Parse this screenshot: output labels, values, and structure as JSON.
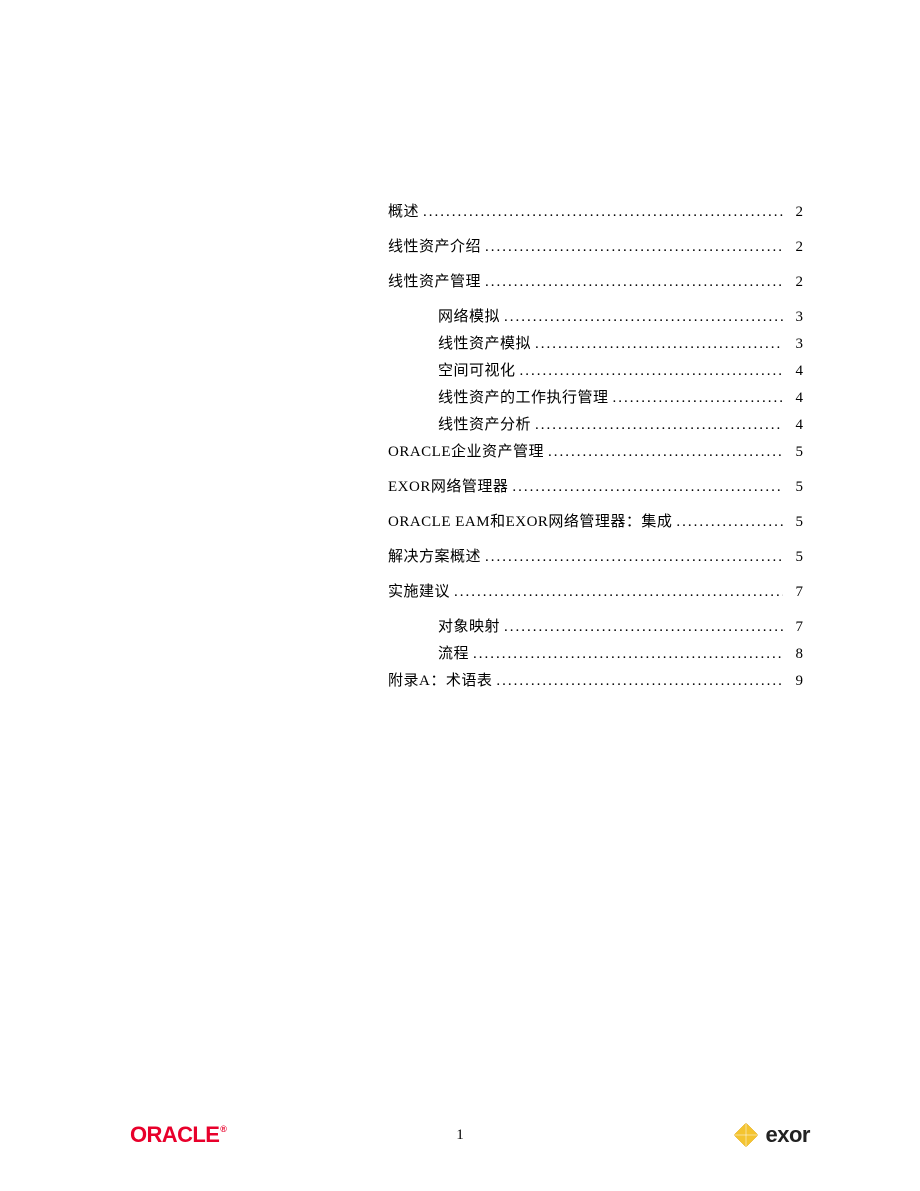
{
  "toc": [
    {
      "label": "概述",
      "page": "2",
      "level": 0
    },
    {
      "label": "线性资产介绍",
      "page": "2",
      "level": 0
    },
    {
      "label": "线性资产管理",
      "page": "2",
      "level": 0
    },
    {
      "label": "网络模拟",
      "page": "3",
      "level": 1
    },
    {
      "label": "线性资产模拟",
      "page": "3",
      "level": 1
    },
    {
      "label": "空间可视化",
      "page": "4",
      "level": 1
    },
    {
      "label": "线性资产的工作执行管理",
      "page": "4",
      "level": 1
    },
    {
      "label": "线性资产分析",
      "page": "4",
      "level": 1
    },
    {
      "label": "ORACLE企业资产管理",
      "page": "5",
      "level": 0
    },
    {
      "label": "EXOR网络管理器",
      "page": "5",
      "level": 0
    },
    {
      "label": "ORACLE EAM和EXOR网络管理器：集成",
      "page": "5",
      "level": 0
    },
    {
      "label": "解决方案概述",
      "page": "5",
      "level": 0
    },
    {
      "label": "实施建议",
      "page": "7",
      "level": 0
    },
    {
      "label": "对象映射",
      "page": "7",
      "level": 1
    },
    {
      "label": "流程",
      "page": "8",
      "level": 1
    },
    {
      "label": "附录A：术语表",
      "page": "9",
      "level": 0
    }
  ],
  "footer": {
    "oracle_text": "ORACLE",
    "page_number": "1",
    "exor_text": "exor"
  }
}
